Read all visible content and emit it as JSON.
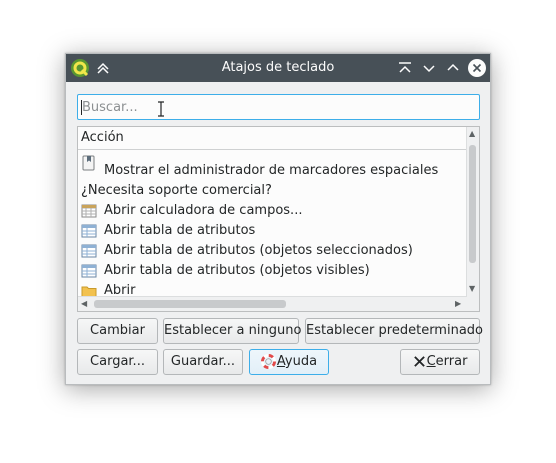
{
  "window": {
    "title": "Atajos de teclado"
  },
  "search": {
    "placeholder": "Buscar..."
  },
  "list": {
    "header": "Acción",
    "rows": [
      {
        "icon": "bookmark-manager-icon",
        "label": "Mostrar el administrador de marcadores espaciales"
      },
      {
        "icon": "",
        "label": "¿Necesita soporte comercial?"
      },
      {
        "icon": "field-calculator-icon",
        "label": "Abrir calculadora de campos..."
      },
      {
        "icon": "attribute-table-icon",
        "label": "Abrir tabla de atributos"
      },
      {
        "icon": "attribute-table-icon",
        "label": "Abrir tabla de atributos (objetos seleccionados)"
      },
      {
        "icon": "attribute-table-icon",
        "label": "Abrir tabla de atributos (objetos visibles)"
      },
      {
        "icon": "folder-icon",
        "label": "Abrir"
      }
    ]
  },
  "buttons": {
    "change": "Cambiar",
    "set_none": "Establecer a ninguno",
    "set_default": "Establecer predeterminado",
    "load": "Cargar...",
    "save": "Guardar...",
    "help_prefix": "A",
    "help_rest": "yuda",
    "close_prefix": "C",
    "close_rest": "errar"
  },
  "colors": {
    "titlebar": "#475057",
    "accent": "#3daee9",
    "background": "#eff0f1"
  }
}
